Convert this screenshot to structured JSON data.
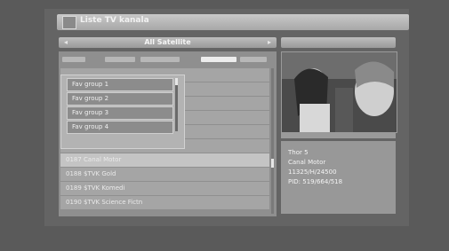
{
  "header": {
    "title": "Liste TV kanala"
  },
  "satellite": {
    "label": "All Satellite",
    "left_arrow": "◂",
    "right_arrow": "▸"
  },
  "tabs": [
    {
      "state": "inactive"
    },
    {
      "state": "inactive"
    },
    {
      "state": "inactive"
    },
    {
      "state": "active"
    },
    {
      "state": "inactive"
    }
  ],
  "fav_groups": [
    "Fav group 1",
    "Fav group 2",
    "Fav group 3",
    "Fav group 4"
  ],
  "channels": [
    {
      "label": ""
    },
    {
      "label": ""
    },
    {
      "label": ""
    },
    {
      "label": ""
    },
    {
      "label": ""
    },
    {
      "label": "0186 la la Civitas"
    },
    {
      "label": "0187 Canal Motor",
      "selected": true
    },
    {
      "label": "0188 $TVK Gold"
    },
    {
      "label": "0189 $TVK Komedi"
    },
    {
      "label": "0190 $TVK Science Fictn"
    }
  ],
  "info": {
    "satellite": "Thor 5",
    "channel": "Canal Motor",
    "frequency": "11325/H/24500",
    "pid": "PID: 519/664/518"
  }
}
